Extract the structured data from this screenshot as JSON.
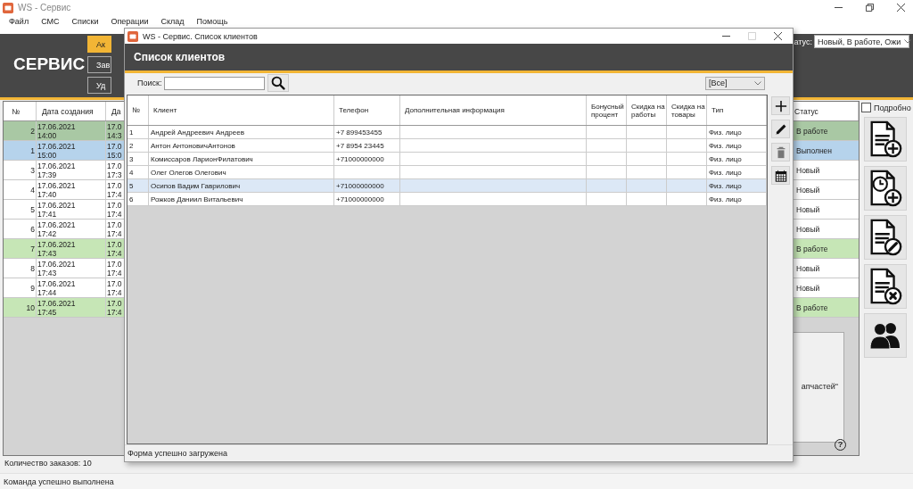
{
  "window": {
    "title": "WS - Сервис"
  },
  "menu": [
    "Файл",
    "СМС",
    "Списки",
    "Операции",
    "Склад",
    "Помощь"
  ],
  "header": {
    "logo": "СЕРВИС",
    "buttons": [
      {
        "label": "Ак",
        "selected": true
      },
      {
        "label": "Зав",
        "selected": false
      },
      {
        "label": "Уд",
        "selected": false
      }
    ],
    "status_label": "атус:",
    "status_filter": "Новый, В работе, Ожи"
  },
  "orders": {
    "columns": [
      "№",
      "Дата создания",
      "Да",
      "Статус"
    ],
    "rows": [
      {
        "number": "2",
        "created": "17.06.2021\n14:00",
        "column_3": "17.0\n14:3",
        "status": "В работе",
        "color": "#a9c8a4"
      },
      {
        "number": "1",
        "created": "17.06.2021\n15:00",
        "column_3": "17.0\n15:0",
        "status": "Выполнен",
        "color": "#b6d3ec"
      },
      {
        "number": "3",
        "created": "17.06.2021\n17:39",
        "column_3": "17.0\n17:3",
        "status": "Новый",
        "color": "#ffffff"
      },
      {
        "number": "4",
        "created": "17.06.2021\n17:40",
        "column_3": "17.0\n17:4",
        "status": "Новый",
        "color": "#ffffff"
      },
      {
        "number": "5",
        "created": "17.06.2021\n17:41",
        "column_3": "17.0\n17:4",
        "status": "Новый",
        "color": "#ffffff"
      },
      {
        "number": "6",
        "created": "17.06.2021\n17:42",
        "column_3": "17.0\n17:4",
        "status": "Новый",
        "color": "#ffffff"
      },
      {
        "number": "7",
        "created": "17.06.2021\n17:43",
        "column_3": "17.0\n17:4",
        "status": "В работе",
        "color": "#c6e6b6"
      },
      {
        "number": "8",
        "created": "17.06.2021\n17:43",
        "column_3": "17.0\n17:4",
        "status": "Новый",
        "color": "#ffffff"
      },
      {
        "number": "9",
        "created": "17.06.2021\n17:44",
        "column_3": "17.0\n17:4",
        "status": "Новый",
        "color": "#ffffff"
      },
      {
        "number": "10",
        "created": "17.06.2021\n17:45",
        "column_3": "17.0\n17:4",
        "status": "В работе",
        "color": "#c6e6b6"
      }
    ]
  },
  "details": {
    "text": "апчастей\"",
    "help": "?"
  },
  "side": {
    "detailed": {
      "label": "Подробно",
      "checked": false
    },
    "tools": [
      {
        "kind": "add"
      },
      {
        "kind": "schedule"
      },
      {
        "kind": "edit"
      },
      {
        "kind": "delete"
      },
      {
        "kind": "people"
      }
    ]
  },
  "footer": {
    "count": "Количество заказов: 10"
  },
  "status_bar": "Команда успешно выполнена",
  "dialog": {
    "title": "WS - Сервис. Список клиентов",
    "heading": "Список клиентов",
    "search": {
      "label": "Поиск:"
    },
    "filter": "[Все]",
    "columns": [
      "№",
      "Клиент",
      "Телефон",
      "Дополнительная информация",
      "Бонусный процент",
      "Скидка на работы",
      "Скидка на товары",
      "Тип"
    ],
    "rows": [
      {
        "number": "1",
        "client": "Андрей Андреевич Андреев",
        "phone": "+7 899453455",
        "type": "Физ. лицо",
        "selected": false
      },
      {
        "number": "2",
        "client": "Антон АнтоновичАнтонов",
        "phone": "+7 8954 23445",
        "type": "Физ. лицо",
        "selected": false
      },
      {
        "number": "3",
        "client": "Комиссаров ЛарионФилатович",
        "phone": "+71000000000",
        "type": "Физ. лицо",
        "selected": false
      },
      {
        "number": "4",
        "client": "Олег Олегов Олегович",
        "type": "Физ. лицо",
        "selected": false
      },
      {
        "number": "5",
        "client": "Осипов Вадим Гаврилович",
        "phone": "+71000000000",
        "type": "Физ. лицо",
        "selected": true
      },
      {
        "number": "6",
        "client": "Рожков Даниил Витальевич",
        "phone": "+71000000000",
        "type": "Физ. лицо",
        "selected": false
      }
    ],
    "tools": [
      {
        "kind": "add"
      },
      {
        "kind": "edit"
      },
      {
        "kind": "delete"
      },
      {
        "kind": "calendar"
      }
    ],
    "status": "Форма успешно загружена"
  }
}
